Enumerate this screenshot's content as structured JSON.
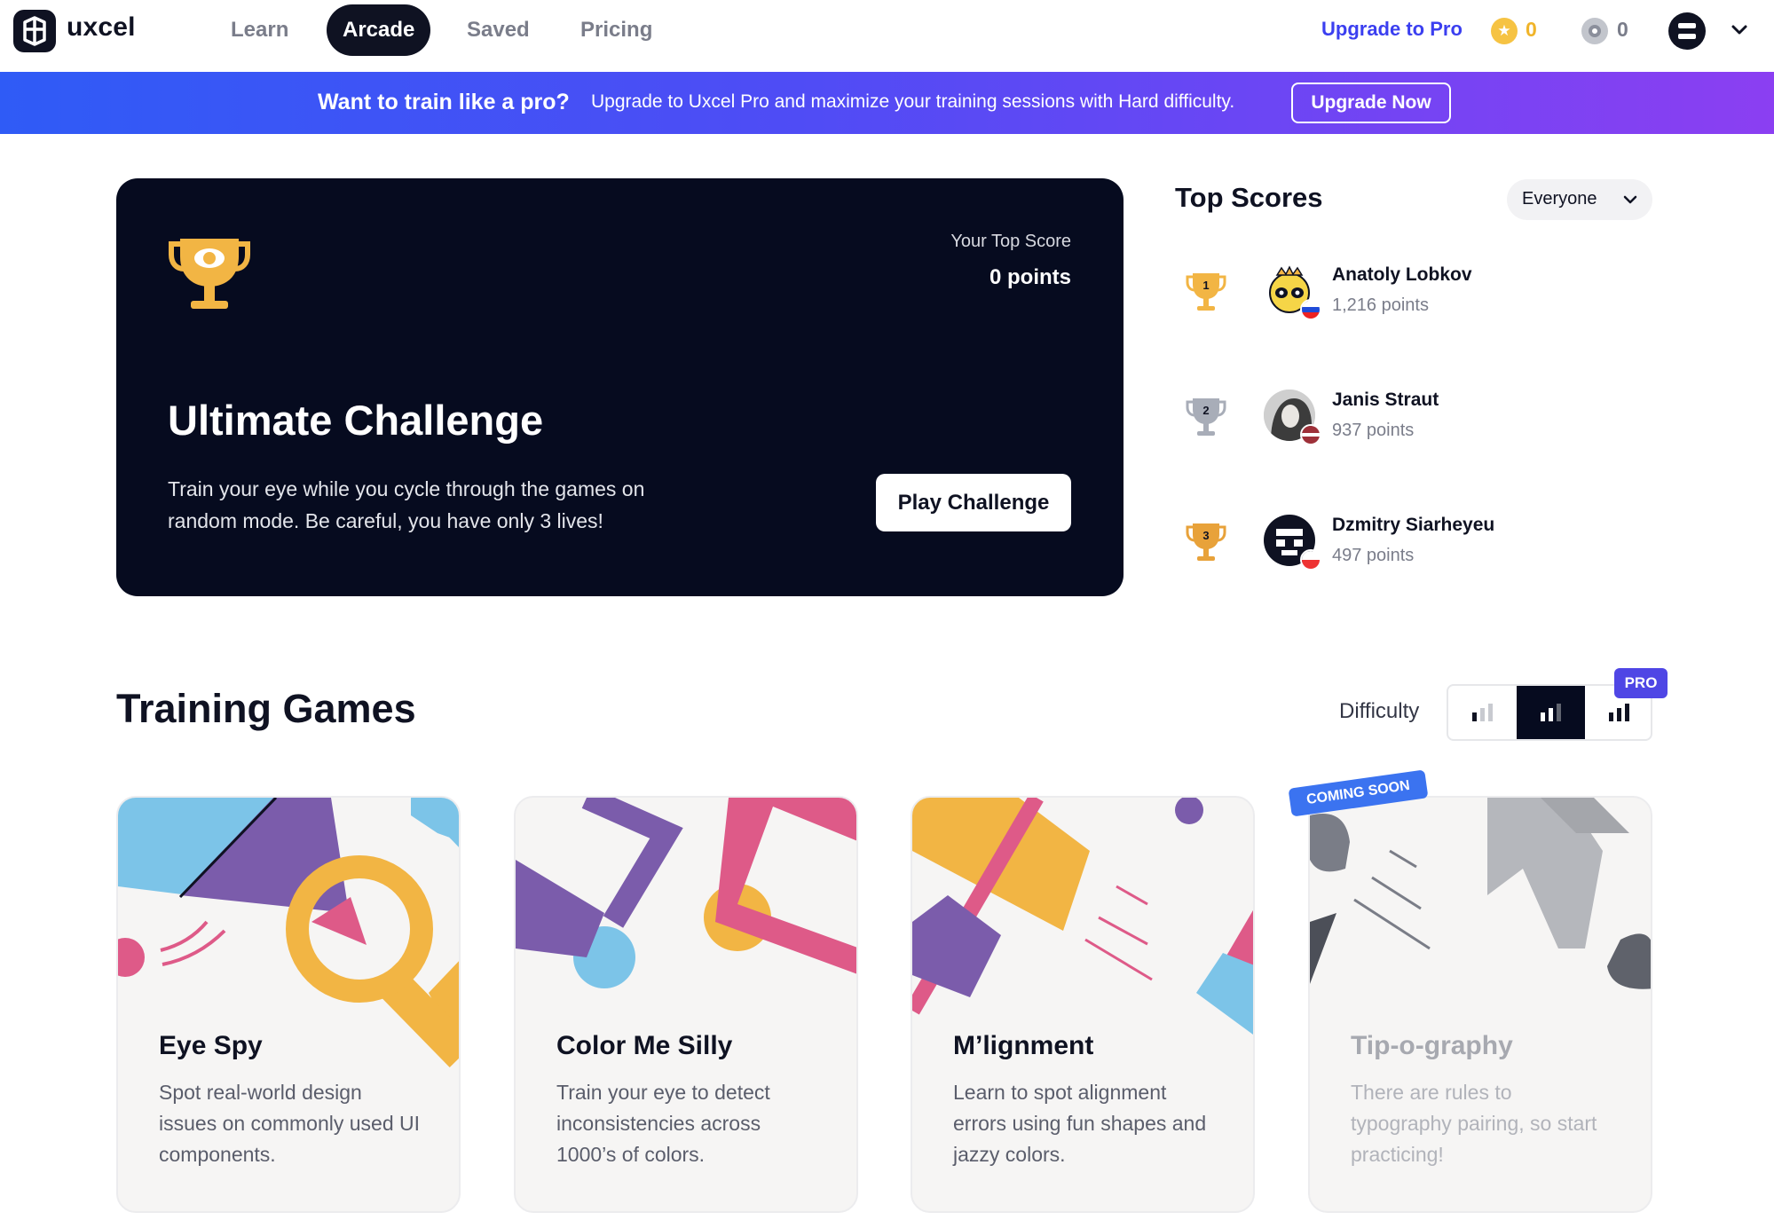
{
  "nav": {
    "brand": "uxcel",
    "items": [
      {
        "label": "Learn",
        "active": false
      },
      {
        "label": "Arcade",
        "active": true
      },
      {
        "label": "Saved",
        "active": false
      },
      {
        "label": "Pricing",
        "active": false
      }
    ],
    "upgrade_label": "Upgrade to Pro",
    "coins": "0",
    "eye_points": "0"
  },
  "banner": {
    "title": "Want to train like a pro?",
    "text": "Upgrade to Uxcel Pro and maximize your training sessions with Hard difficulty.",
    "button": "Upgrade Now"
  },
  "challenge": {
    "top_score_label": "Your Top Score",
    "top_score_value": "0 points",
    "title": "Ultimate Challenge",
    "description": "Train your eye while you cycle through the games on random mode. Be careful, you have only 3 lives!",
    "button": "Play Challenge"
  },
  "top_scores": {
    "title": "Top Scores",
    "filter": "Everyone",
    "players": [
      {
        "rank": "1",
        "name": "Anatoly Lobkov",
        "points": "1,216 points"
      },
      {
        "rank": "2",
        "name": "Janis Straut",
        "points": "937 points"
      },
      {
        "rank": "3",
        "name": "Dzmitry Siarheyeu",
        "points": "497 points"
      }
    ]
  },
  "training": {
    "title": "Training Games",
    "difficulty_label": "Difficulty",
    "selected_difficulty": 2,
    "pro_badge": "PRO",
    "coming_soon": "COMING SOON",
    "games": [
      {
        "title": "Eye Spy",
        "description": "Spot real-world design issues on commonly used UI components."
      },
      {
        "title": "Color Me Silly",
        "description": "Train your eye to detect inconsistencies across 1000’s of colors."
      },
      {
        "title": "M’lignment",
        "description": "Learn to spot alignment errors using fun shapes and jazzy colors."
      },
      {
        "title": "Tip-o-graphy",
        "description": "There are rules to typography pairing, so start practicing!"
      }
    ]
  },
  "colors": {
    "accent": "#3b3ff0",
    "dark": "#060b1f",
    "gold": "#f0b429",
    "purple": "#7b5cab",
    "pink": "#de5a88",
    "blue": "#7cc4e8",
    "orange": "#f2b544"
  },
  "icons": [
    "logo-icon",
    "star-coin-icon",
    "eye-coin-icon",
    "chevron-down-icon",
    "trophy-icon",
    "difficulty-bars-icon"
  ]
}
